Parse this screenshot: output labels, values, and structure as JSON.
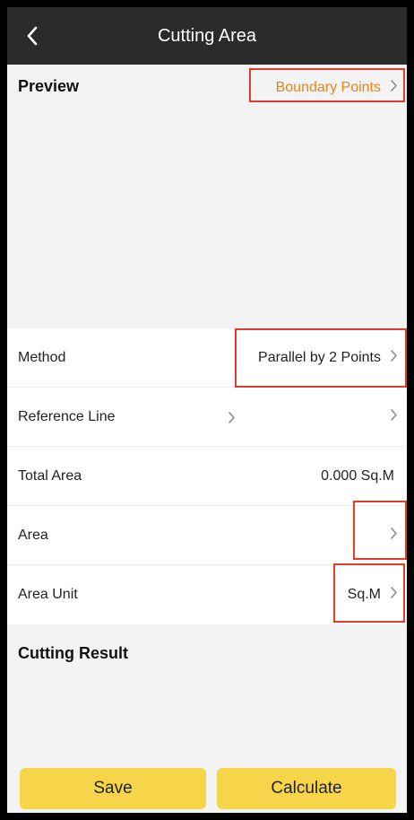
{
  "header": {
    "title": "Cutting Area",
    "back_icon": "chevron-left-icon"
  },
  "preview": {
    "title": "Preview",
    "link_label": "Boundary Points",
    "link_color": "#e8831c"
  },
  "settings": {
    "method": {
      "label": "Method",
      "value": "Parallel by 2 Points"
    },
    "reference_line": {
      "label": "Reference Line"
    },
    "total_area": {
      "label": "Total Area",
      "value": "0.000 Sq.M"
    },
    "area": {
      "label": "Area"
    },
    "area_unit": {
      "label": "Area Unit",
      "value": "Sq.M"
    }
  },
  "result": {
    "title": "Cutting Result"
  },
  "buttons": {
    "save": "Save",
    "calculate": "Calculate",
    "color": "#f6d54a"
  },
  "highlight_color": "#e53b2a"
}
